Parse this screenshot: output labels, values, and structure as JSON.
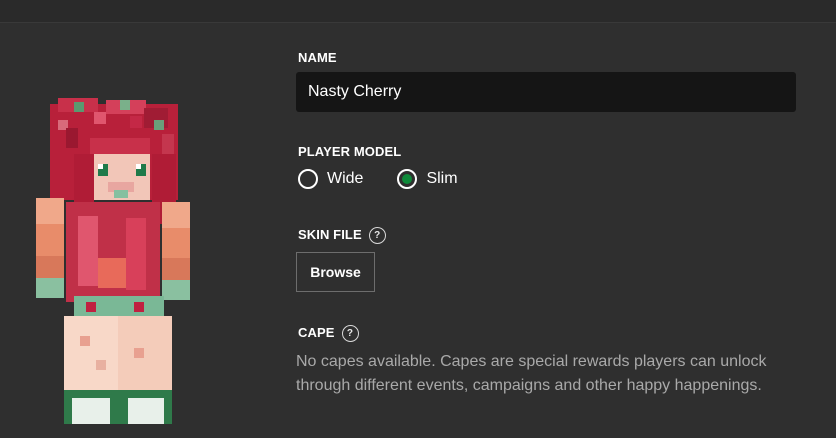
{
  "form": {
    "name": {
      "label": "NAME",
      "value": "Nasty Cherry"
    },
    "player_model": {
      "label": "PLAYER MODEL",
      "options": [
        {
          "label": "Wide",
          "selected": false
        },
        {
          "label": "Slim",
          "selected": true
        }
      ]
    },
    "skin_file": {
      "label": "SKIN FILE",
      "help": "?",
      "browse_label": "Browse"
    },
    "cape": {
      "label": "CAPE",
      "help": "?",
      "description": "No capes available. Capes are special rewards players can unlock through different events, campaigns and other happy happenings."
    }
  },
  "colors": {
    "background": "#2f2f2f",
    "input_bg": "#151515",
    "radio_selected": "#0f8a3a",
    "muted_text": "#a9a9a9"
  },
  "icons": {
    "skin_preview": "skin-preview-image",
    "help": "help-icon"
  }
}
